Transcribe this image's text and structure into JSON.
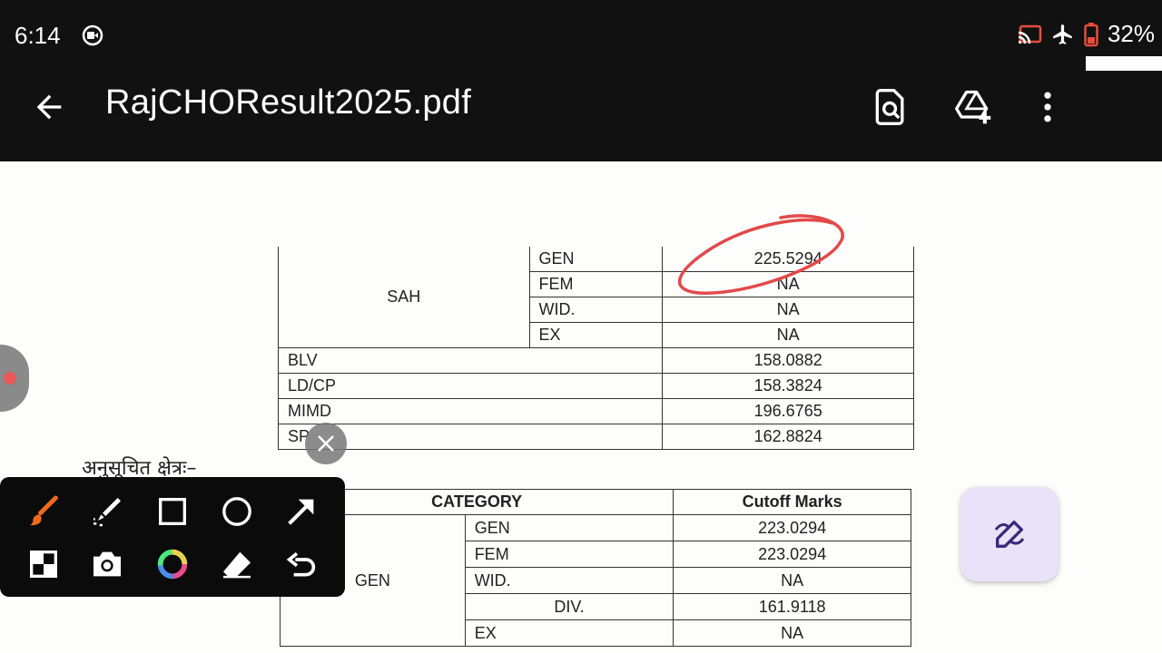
{
  "status": {
    "time": "6:14",
    "battery": "32%"
  },
  "header": {
    "title": "RajCHOResult2025.pdf"
  },
  "icons": {
    "back": "arrow-back-icon",
    "search_doc": "document-search-icon",
    "drive_add": "drive-add-icon",
    "more": "more-vert-icon"
  },
  "table1": {
    "group": "SAH",
    "sub_rows": [
      {
        "label": "GEN",
        "value": "225.5294"
      },
      {
        "label": "FEM",
        "value": "NA"
      },
      {
        "label": "WID.",
        "value": "NA"
      },
      {
        "label": "EX",
        "value": "NA"
      }
    ],
    "rows": [
      {
        "label": "BLV",
        "value": "158.0882"
      },
      {
        "label": "LD/CP",
        "value": "158.3824"
      },
      {
        "label": "MIMD",
        "value": "196.6765"
      },
      {
        "label": "SP",
        "value": "162.8824"
      }
    ]
  },
  "section_heading": "अनुसूचित क्षेत्रः–",
  "table2": {
    "header_category": "CATEGORY",
    "header_cutoff": "Cutoff Marks",
    "group": "GEN",
    "rows": [
      {
        "label": "GEN",
        "value": "223.0294"
      },
      {
        "label": "FEM",
        "value": "223.0294"
      },
      {
        "label": "WID.",
        "value": "NA"
      },
      {
        "label": "DIV.",
        "value": "161.9118"
      },
      {
        "label": "EX",
        "value": "NA"
      }
    ]
  },
  "colors": {
    "annotation": "#e24a4a",
    "bar_bg": "#111111",
    "fab_bg": "#e8e3f8",
    "brush": "#f06a1e"
  }
}
